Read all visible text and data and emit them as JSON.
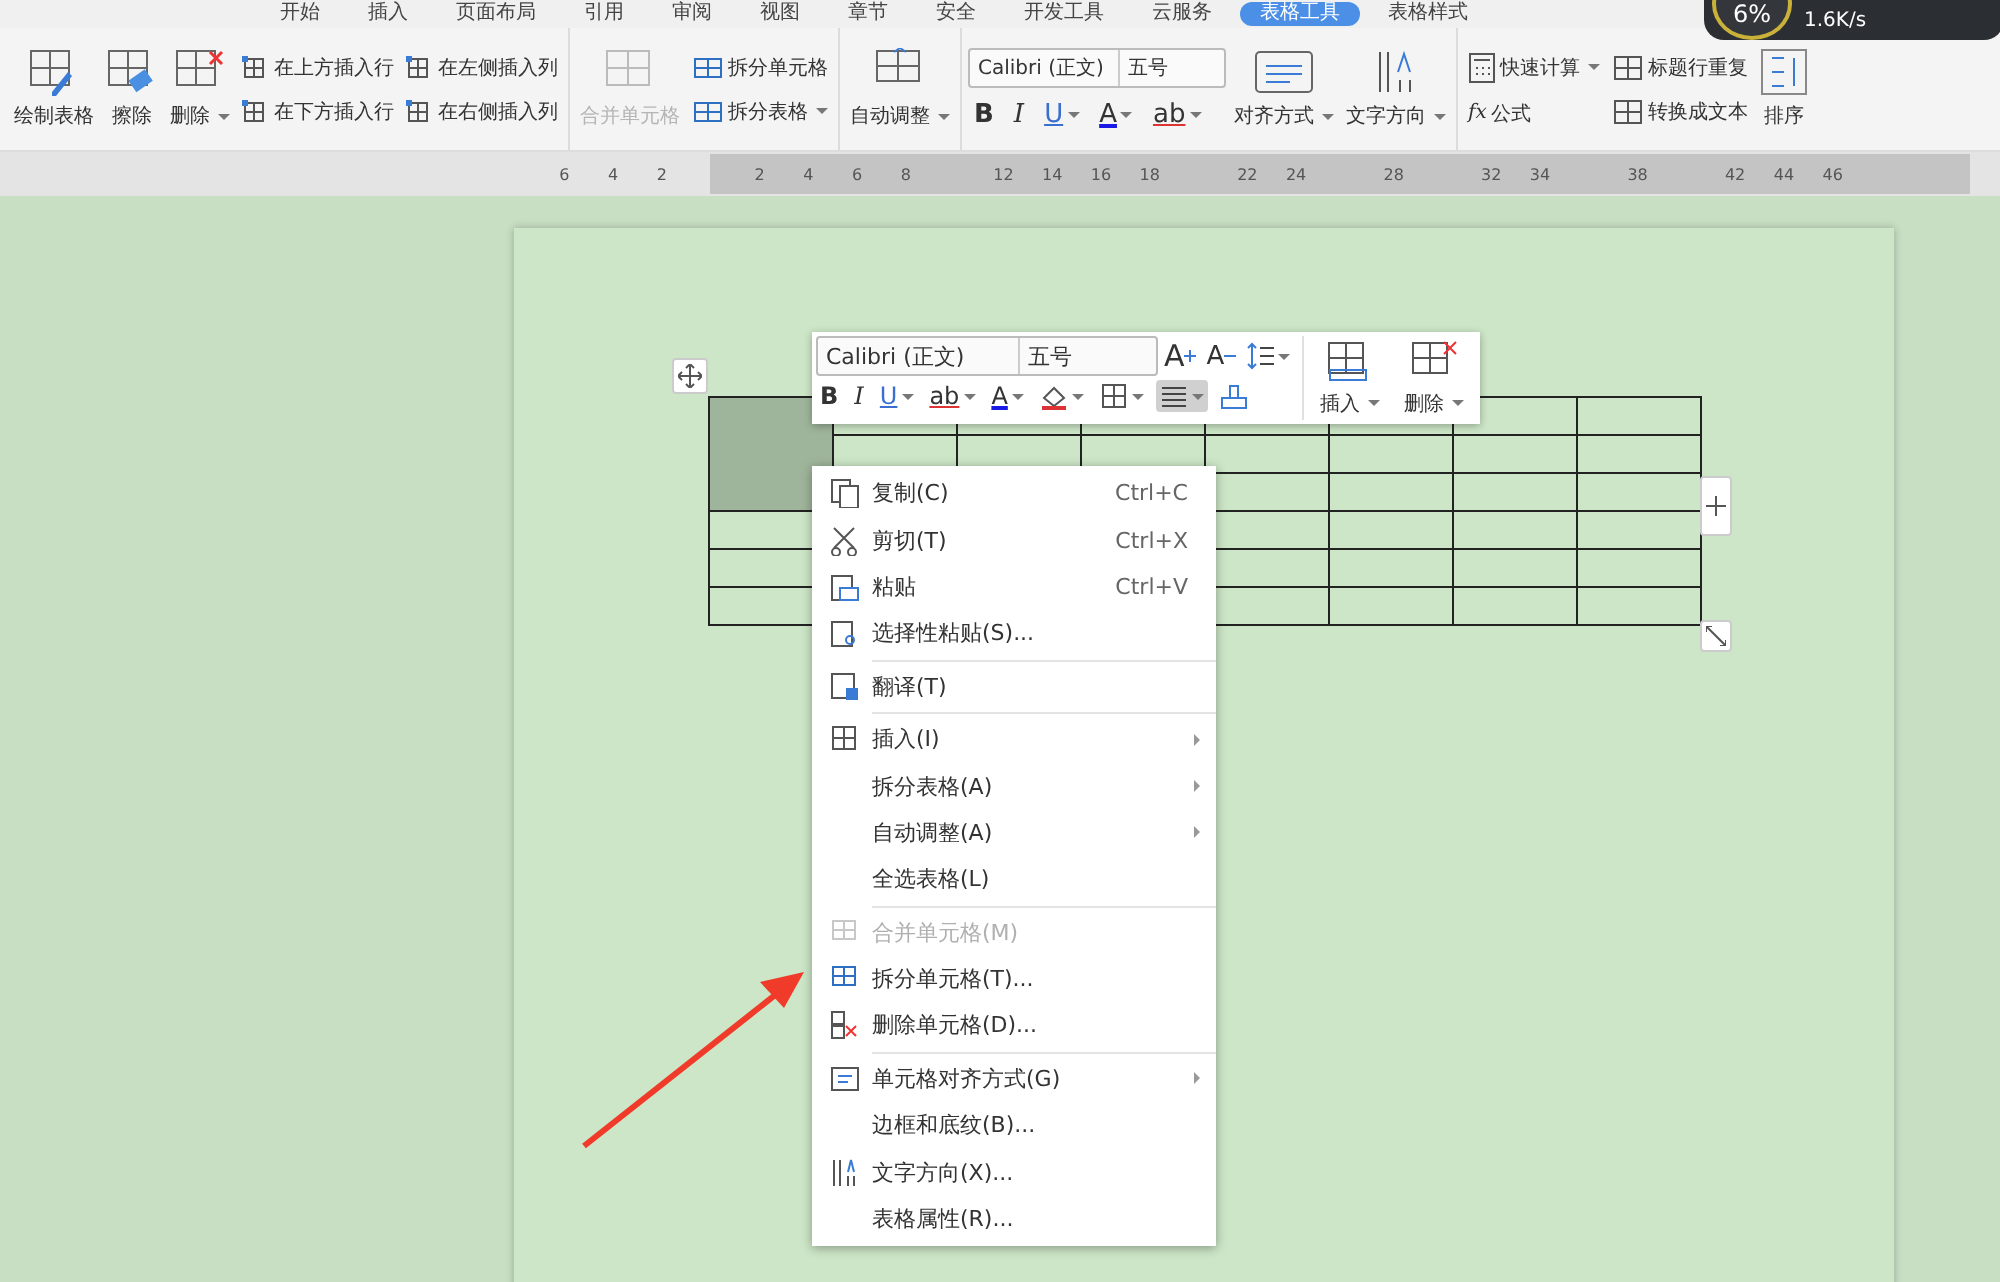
{
  "ribbon_tabs": [
    {
      "label": "开始",
      "selected": false
    },
    {
      "label": "插入",
      "selected": false
    },
    {
      "label": "页面布局",
      "selected": false
    },
    {
      "label": "引用",
      "selected": false
    },
    {
      "label": "审阅",
      "selected": false
    },
    {
      "label": "视图",
      "selected": false
    },
    {
      "label": "章节",
      "selected": false
    },
    {
      "label": "安全",
      "selected": false
    },
    {
      "label": "开发工具",
      "selected": false
    },
    {
      "label": "云服务",
      "selected": false
    },
    {
      "label": "表格工具",
      "selected": true
    },
    {
      "label": "表格样式",
      "selected": false
    }
  ],
  "speed_widget": {
    "percent": "6%",
    "speed": "1.6K/s"
  },
  "ribbon": {
    "table_buttons": [
      {
        "label": "绘制表格",
        "dropdown": false
      },
      {
        "label": "擦除",
        "dropdown": false
      },
      {
        "label": "删除",
        "dropdown": true
      }
    ],
    "insert_buttons": [
      {
        "label": "在上方插入行"
      },
      {
        "label": "在下方插入行"
      },
      {
        "label": "在左侧插入列"
      },
      {
        "label": "在右侧插入列"
      }
    ],
    "merge_button": {
      "label": "合并单元格",
      "disabled": true
    },
    "split_buttons": [
      {
        "label": "拆分单元格",
        "dropdown": false
      },
      {
        "label": "拆分表格",
        "dropdown": true
      }
    ],
    "autofit_button": {
      "label": "自动调整",
      "dropdown": true
    },
    "font": {
      "name": "Calibri (正文)",
      "size": "五号"
    },
    "format_buttons": [
      {
        "glyph": "B",
        "dropdown": false
      },
      {
        "glyph": "I",
        "dropdown": false
      },
      {
        "glyph": "U",
        "dropdown": true
      },
      {
        "glyph": "A",
        "dropdown": true
      },
      {
        "glyph": "ab",
        "dropdown": true
      }
    ],
    "layout_buttons": [
      {
        "label": "对齐方式",
        "dropdown": true
      },
      {
        "label": "文字方向",
        "dropdown": true
      }
    ],
    "calc_buttons": [
      {
        "label": "快速计算",
        "dropdown": true
      },
      {
        "label": "公式",
        "glyph": "fx",
        "dropdown": false
      }
    ],
    "convert_buttons": [
      {
        "label": "标题行重复"
      },
      {
        "label": "转换成文本"
      }
    ],
    "sort_button": {
      "label": "排序"
    }
  },
  "ruler": {
    "labels": [
      {
        "label": "6",
        "gap_before": false
      },
      {
        "label": "4",
        "gap_before": false
      },
      {
        "label": "2",
        "gap_before": false
      },
      {
        "label": "2",
        "gap_before": true
      },
      {
        "label": "4",
        "gap_before": false
      },
      {
        "label": "6",
        "gap_before": false
      },
      {
        "label": "8",
        "gap_before": false
      },
      {
        "label": "12",
        "gap_before": true
      },
      {
        "label": "14",
        "gap_before": false
      },
      {
        "label": "16",
        "gap_before": false
      },
      {
        "label": "18",
        "gap_before": false
      },
      {
        "label": "22",
        "gap_before": true
      },
      {
        "label": "24",
        "gap_before": false
      },
      {
        "label": "28",
        "gap_before": true
      },
      {
        "label": "32",
        "gap_before": true
      },
      {
        "label": "34",
        "gap_before": false
      },
      {
        "label": "38",
        "gap_before": true
      },
      {
        "label": "42",
        "gap_before": true
      },
      {
        "label": "44",
        "gap_before": false
      },
      {
        "label": "46",
        "gap_before": false
      }
    ]
  },
  "table": {
    "first_cell_selected": true
  },
  "mini_toolbar": {
    "font": "Calibri (正文)",
    "size": "五号",
    "grow_glyph": "A",
    "shrink_glyph": "A",
    "format_buttons": [
      {
        "kind": "glyph",
        "glyph": "B",
        "dropdown": false,
        "active": false
      },
      {
        "kind": "glyph",
        "glyph": "I",
        "dropdown": false,
        "active": false
      },
      {
        "kind": "glyph",
        "glyph": "U",
        "dropdown": true,
        "active": false
      },
      {
        "kind": "glyph",
        "glyph": "ab",
        "dropdown": true,
        "active": false
      },
      {
        "kind": "glyph",
        "glyph": "A",
        "dropdown": true,
        "active": false
      },
      {
        "kind": "fill",
        "dropdown": true,
        "active": false
      },
      {
        "kind": "border",
        "dropdown": true,
        "active": false
      },
      {
        "kind": "align",
        "dropdown": true,
        "active": true
      },
      {
        "kind": "brush",
        "dropdown": false,
        "active": false
      }
    ],
    "big_buttons": [
      {
        "label": "插入",
        "dropdown": true
      },
      {
        "label": "删除",
        "dropdown": true
      }
    ]
  },
  "context_menu": {
    "items": [
      {
        "kind": "item",
        "label": "复制(C)",
        "shortcut": "Ctrl+C",
        "submenu": false,
        "disabled": false
      },
      {
        "kind": "item",
        "label": "剪切(T)",
        "shortcut": "Ctrl+X",
        "submenu": false,
        "disabled": false
      },
      {
        "kind": "item",
        "label": "粘贴",
        "shortcut": "Ctrl+V",
        "submenu": false,
        "disabled": false
      },
      {
        "kind": "item",
        "label": "选择性粘贴(S)...",
        "submenu": false,
        "disabled": false
      },
      {
        "kind": "separator"
      },
      {
        "kind": "item",
        "label": "翻译(T)",
        "submenu": false,
        "disabled": false
      },
      {
        "kind": "separator"
      },
      {
        "kind": "item",
        "label": "插入(I)",
        "submenu": true,
        "disabled": false
      },
      {
        "kind": "item",
        "label": "拆分表格(A)",
        "submenu": true,
        "disabled": false
      },
      {
        "kind": "item",
        "label": "自动调整(A)",
        "submenu": true,
        "disabled": false
      },
      {
        "kind": "item",
        "label": "全选表格(L)",
        "submenu": false,
        "disabled": false
      },
      {
        "kind": "separator"
      },
      {
        "kind": "item",
        "label": "合并单元格(M)",
        "submenu": false,
        "disabled": true
      },
      {
        "kind": "item",
        "label": "拆分单元格(T)...",
        "submenu": false,
        "disabled": false
      },
      {
        "kind": "item",
        "label": "删除单元格(D)...",
        "submenu": false,
        "disabled": false
      },
      {
        "kind": "separator"
      },
      {
        "kind": "item",
        "label": "单元格对齐方式(G)",
        "submenu": true,
        "disabled": false
      },
      {
        "kind": "item",
        "label": "边框和底纹(B)...",
        "submenu": false,
        "disabled": false
      },
      {
        "kind": "item",
        "label": "文字方向(X)...",
        "submenu": false,
        "disabled": false
      },
      {
        "kind": "item",
        "label": "表格属性(R)...",
        "submenu": false,
        "disabled": false
      }
    ]
  }
}
